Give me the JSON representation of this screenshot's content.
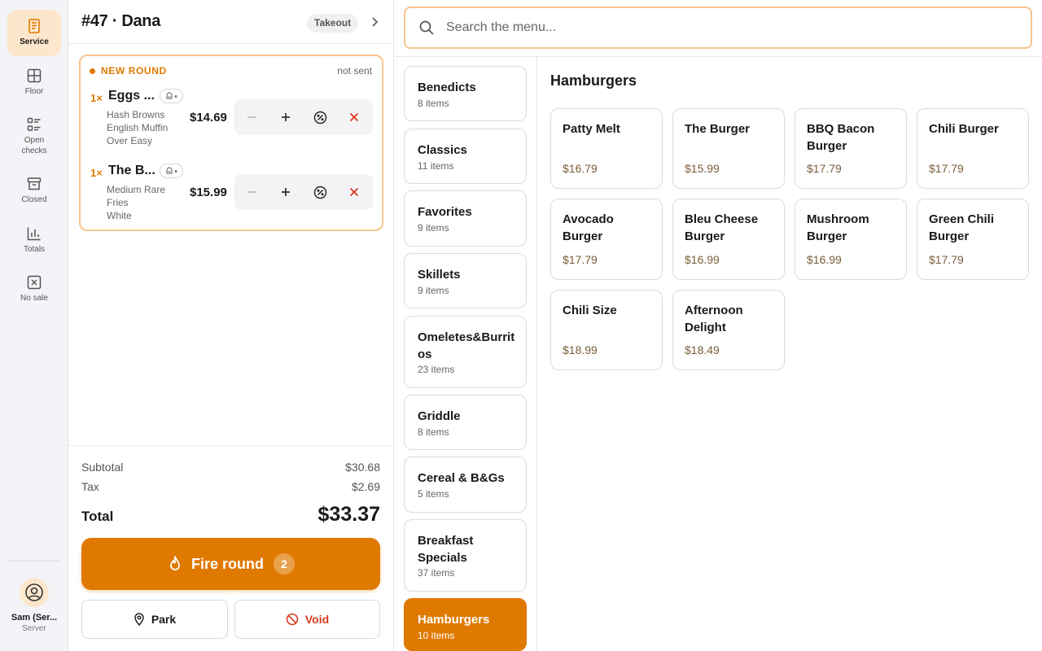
{
  "rail": {
    "items": [
      {
        "label": "Service",
        "icon": "receipt-icon"
      },
      {
        "label": "Floor",
        "icon": "grid-icon"
      },
      {
        "label": "Open checks",
        "icon": "list-icon"
      },
      {
        "label": "Closed",
        "icon": "archive-icon"
      },
      {
        "label": "Totals",
        "icon": "bar-chart-icon"
      },
      {
        "label": "No sale",
        "icon": "x-box-icon"
      }
    ],
    "user": {
      "name": "Sam (Ser...",
      "role": "Server"
    }
  },
  "order": {
    "title": "#47 · Dana",
    "type": "Takeout",
    "round_label": "NEW ROUND",
    "round_status": "not sent",
    "items": [
      {
        "qty": "1×",
        "name": "Eggs ...",
        "mods": [
          "Hash Browns",
          "English Muffin",
          "Over Easy"
        ],
        "price": "$14.69"
      },
      {
        "qty": "1×",
        "name": "The B...",
        "mods": [
          "Medium Rare",
          "Fries",
          "White"
        ],
        "price": "$15.99"
      }
    ],
    "subtotal_label": "Subtotal",
    "subtotal": "$30.68",
    "tax_label": "Tax",
    "tax": "$2.69",
    "total_label": "Total",
    "total": "$33.37",
    "fire_label": "Fire round",
    "fire_count": "2",
    "park_label": "Park",
    "void_label": "Void"
  },
  "search": {
    "placeholder": "Search the menu..."
  },
  "categories": [
    {
      "name": "Benedicts",
      "count": "8 items"
    },
    {
      "name": "Classics",
      "count": "11 items"
    },
    {
      "name": "Favorites",
      "count": "9 items"
    },
    {
      "name": "Skillets",
      "count": "9 items"
    },
    {
      "name": "Omeletes&Burritos",
      "count": "23 items"
    },
    {
      "name": "Griddle",
      "count": "8 items"
    },
    {
      "name": "Cereal & B&Gs",
      "count": "5 items"
    },
    {
      "name": "Breakfast Specials",
      "count": "37 items"
    },
    {
      "name": "Hamburgers",
      "count": "10 items",
      "active": true
    }
  ],
  "menu": {
    "title": "Hamburgers",
    "items": [
      {
        "name": "Patty Melt",
        "price": "$16.79"
      },
      {
        "name": "The Burger",
        "price": "$15.99"
      },
      {
        "name": "BBQ Bacon Burger",
        "price": "$17.79"
      },
      {
        "name": "Chili Burger",
        "price": "$17.79"
      },
      {
        "name": "Avocado Burger",
        "price": "$17.79"
      },
      {
        "name": "Bleu Cheese Burger",
        "price": "$16.99"
      },
      {
        "name": "Mushroom Burger",
        "price": "$16.99"
      },
      {
        "name": "Green Chili Burger",
        "price": "$17.79"
      },
      {
        "name": "Chili Size",
        "price": "$18.99"
      },
      {
        "name": "Afternoon Delight",
        "price": "$18.49"
      }
    ]
  },
  "colors": {
    "accent": "#e07900",
    "accent_light": "#fde7cc",
    "danger": "#d93a1e"
  }
}
